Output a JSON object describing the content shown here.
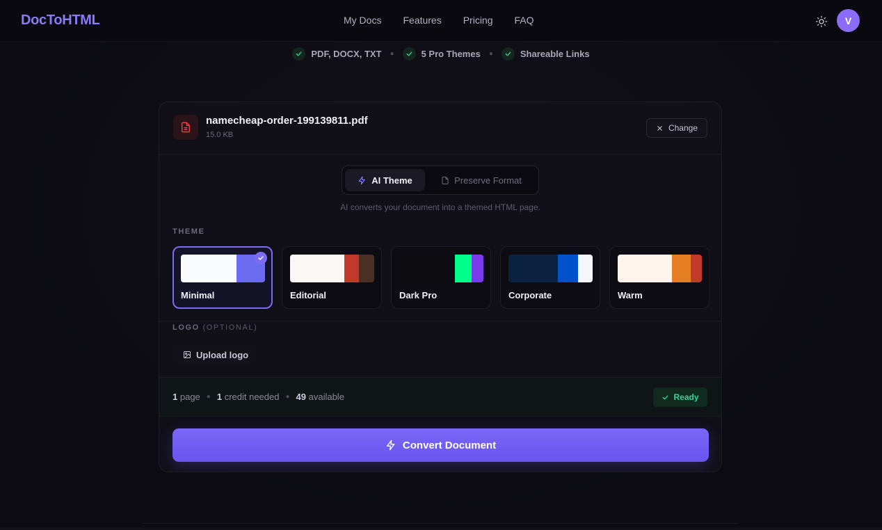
{
  "header": {
    "logo": "DocToHTML",
    "nav": [
      "My Docs",
      "Features",
      "Pricing",
      "FAQ"
    ],
    "avatar_initial": "V"
  },
  "features": [
    "PDF, DOCX, TXT",
    "5 Pro Themes",
    "Shareable Links"
  ],
  "file": {
    "name": "namecheap-order-199139811.pdf",
    "size": "15.0 KB",
    "change_label": "Change"
  },
  "mode": {
    "ai_label": "AI Theme",
    "preserve_label": "Preserve Format",
    "selected": "AI Theme",
    "description": "AI converts your document into a themed HTML page."
  },
  "theme_section": {
    "label": "THEME",
    "selected": "Minimal",
    "themes": [
      {
        "name": "Minimal",
        "colors": [
          "#fafbfd",
          "#6b6cf0"
        ]
      },
      {
        "name": "Editorial",
        "colors": [
          "#faf8f4",
          "#c0392b",
          "#4a2f24"
        ]
      },
      {
        "name": "Dark Pro",
        "colors": [
          "#0b0b10",
          "#00ff88",
          "#7c3aed"
        ]
      },
      {
        "name": "Corporate",
        "colors": [
          "#0b2340",
          "#0052cc",
          "#f4f6fa"
        ]
      },
      {
        "name": "Warm",
        "colors": [
          "#fff5ec",
          "#e67e22",
          "#c0392b"
        ]
      }
    ]
  },
  "logo_section": {
    "label": "LOGO",
    "optional": "(OPTIONAL)",
    "upload_label": "Upload logo"
  },
  "stats": {
    "pages": "1",
    "pages_label": "page",
    "credits": "1",
    "credits_label": "credit needed",
    "available": "49",
    "available_label": "available",
    "status": "Ready"
  },
  "convert_label": "Convert Document",
  "colors": {
    "accent": "#7b66f7",
    "ready": "#34d399",
    "file_icon": "#ef4444"
  }
}
